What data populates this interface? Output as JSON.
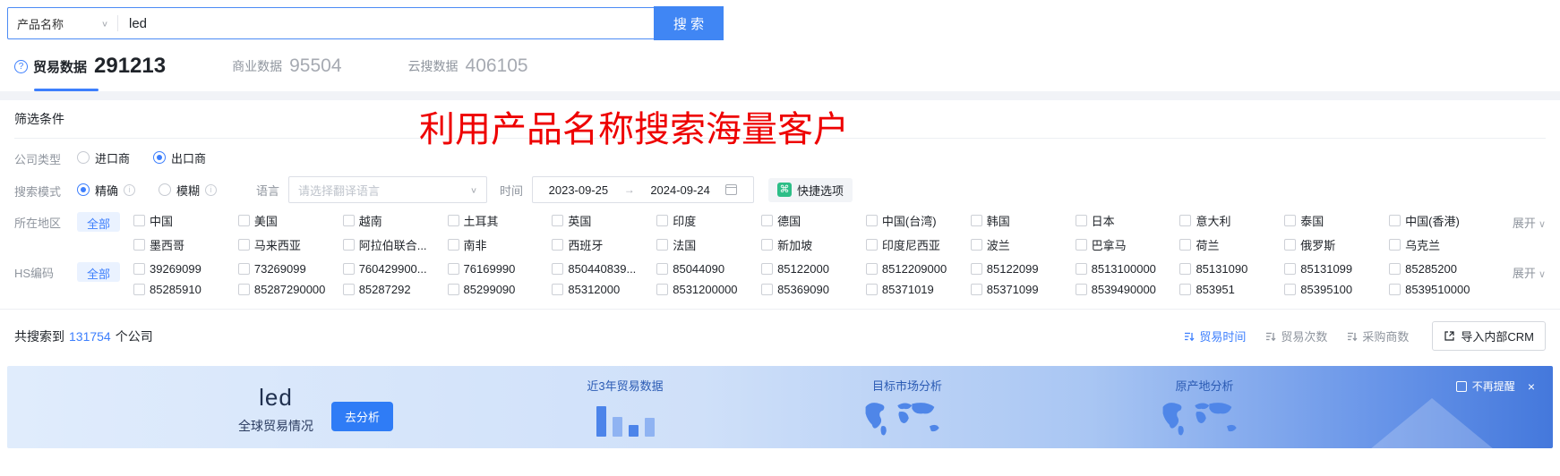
{
  "search_bar": {
    "category_selector": "产品名称",
    "input_value": "led",
    "search_button": "搜 索"
  },
  "tabs": [
    {
      "label": "贸易数据",
      "count": "291213",
      "active": true
    },
    {
      "label": "商业数据",
      "count": "95504",
      "active": false
    },
    {
      "label": "云搜数据",
      "count": "406105",
      "active": false
    }
  ],
  "overlay_text": "利用产品名称搜索海量客户",
  "filters": {
    "section_title": "筛选条件",
    "company_type": {
      "label": "公司类型",
      "options": [
        {
          "label": "进口商",
          "selected": false
        },
        {
          "label": "出口商",
          "selected": true
        }
      ]
    },
    "search_mode": {
      "label": "搜索模式",
      "options": [
        {
          "label": "精确",
          "selected": true
        },
        {
          "label": "模糊",
          "selected": false
        }
      ],
      "language_label": "语言",
      "language_placeholder": "请选择翻译语言",
      "time_label": "时间",
      "date_start": "2023-09-25",
      "date_end": "2024-09-24",
      "quick_option": "快捷选项"
    },
    "region": {
      "label": "所在地区",
      "all_label": "全部",
      "expand_label": "展开",
      "items": [
        "中国",
        "美国",
        "越南",
        "土耳其",
        "英国",
        "印度",
        "德国",
        "中国(台湾)",
        "韩国",
        "日本",
        "意大利",
        "泰国",
        "中国(香港)",
        "墨西哥",
        "马来西亚",
        "阿拉伯联合...",
        "南非",
        "西班牙",
        "法国",
        "新加坡",
        "印度尼西亚",
        "波兰",
        "巴拿马",
        "荷兰",
        "俄罗斯",
        "乌克兰"
      ]
    },
    "hs_code": {
      "label": "HS编码",
      "all_label": "全部",
      "expand_label": "展开",
      "items": [
        "39269099",
        "73269099",
        "760429900...",
        "76169990",
        "850440839...",
        "85044090",
        "85122000",
        "8512209000",
        "85122099",
        "8513100000",
        "85131090",
        "85131099",
        "85285200",
        "85285910",
        "85287290000",
        "85287292",
        "85299090",
        "85312000",
        "8531200000",
        "85369090",
        "85371019",
        "85371099",
        "8539490000",
        "853951",
        "85395100",
        "8539510000"
      ]
    }
  },
  "results_bar": {
    "prefix": "共搜索到",
    "count": "131754",
    "suffix": "个公司",
    "sort_options": [
      {
        "label": "贸易时间",
        "active": true
      },
      {
        "label": "贸易次数",
        "active": false
      },
      {
        "label": "采购商数",
        "active": false
      }
    ],
    "crm_button": "导入内部CRM"
  },
  "banner": {
    "keyword": "led",
    "subtitle": "全球贸易情况",
    "analyze_button": "去分析",
    "trade_chart_label": "近3年贸易数据",
    "market_label": "目标市场分析",
    "origin_label": "原产地分析",
    "dismiss_label": "不再提醒",
    "close_icon": "×"
  },
  "colors": {
    "accent_blue": "#3D7FFD",
    "button_blue": "#4086F4",
    "quick_green": "#2DBE87",
    "overlay_red": "#EE0000",
    "banner_text_blue": "#2B5BB4"
  }
}
